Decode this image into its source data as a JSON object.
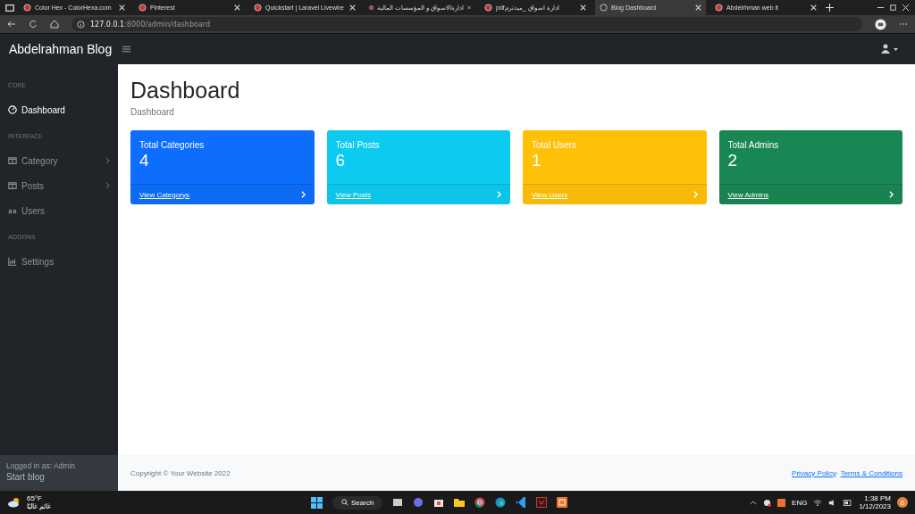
{
  "browser": {
    "tabs": [
      {
        "title": "Color Hex - ColorHexa.com",
        "selected": false
      },
      {
        "title": "Pinterest",
        "selected": false
      },
      {
        "title": "Quickstart | Laravel Livewire",
        "selected": false
      },
      {
        "title": "ادارةالاسواق و المؤسسات المالية",
        "selected": false
      },
      {
        "title": "pdfادارة اسواق _ميدترم",
        "selected": false
      },
      {
        "title": "Blog Dashboard",
        "selected": true
      },
      {
        "title": "Abdelrhman web it",
        "selected": false
      }
    ],
    "url_host": "127.0.0.1",
    "url_path": ":8000/admin/dashboard"
  },
  "navbar": {
    "brand": "Abdelrahman Blog"
  },
  "sidebar": {
    "sections": [
      {
        "heading": "CORE",
        "items": [
          {
            "label": "Dashboard",
            "selected": true,
            "expandable": false
          }
        ]
      },
      {
        "heading": "INTERFACE",
        "items": [
          {
            "label": "Category",
            "selected": false,
            "expandable": true
          },
          {
            "label": "Posts",
            "selected": false,
            "expandable": true
          },
          {
            "label": "Users",
            "selected": false,
            "expandable": false
          }
        ]
      },
      {
        "heading": "ADDONS",
        "items": [
          {
            "label": "Settings",
            "selected": false,
            "expandable": false
          }
        ]
      }
    ],
    "footer_label": "Logged in as: Admin",
    "footer_value": "Start blog"
  },
  "page": {
    "title": "Dashboard",
    "breadcrumb": "Dashboard"
  },
  "cards": [
    {
      "label": "Total Categories",
      "value": "4",
      "link": "View Categorys",
      "color": "#0d6efd"
    },
    {
      "label": "Total Posts",
      "value": "6",
      "link": "View Posts",
      "color": "#0dcaf0"
    },
    {
      "label": "Total Users",
      "value": "1",
      "link": "View Users",
      "color": "#ffc107"
    },
    {
      "label": "Total Admins",
      "value": "2",
      "link": "View Admins",
      "color": "#198754"
    }
  ],
  "footer": {
    "copyright": "Copyright © Your Website 2022",
    "links": [
      "Privacy Policy",
      "Terms & Conditions"
    ],
    "separator": "·"
  },
  "taskbar": {
    "temperature": "65°F",
    "weather": "غائم غالبًا",
    "search": "Search",
    "language": "ENG",
    "time": "1:38 PM",
    "date": "1/12/2023",
    "notifications": "6"
  }
}
